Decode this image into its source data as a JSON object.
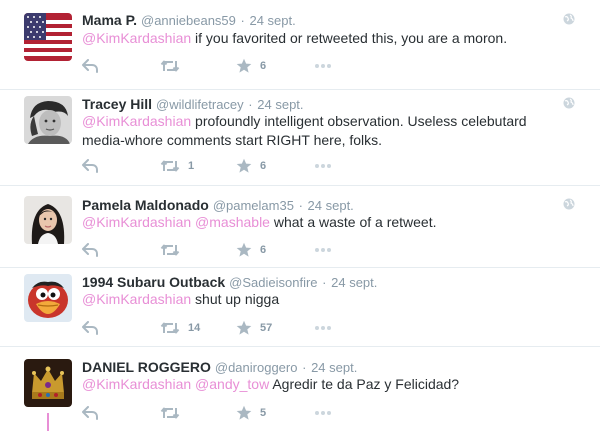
{
  "tweets": [
    {
      "name": "Mama P.",
      "handle": "@anniebeans59",
      "sep": "·",
      "time": "24 sept.",
      "mention1": "@KimKardashian",
      "mention2": "",
      "text": " if you favorited or retweeted this, you are a moron.",
      "retweets": "",
      "favorites": "6",
      "avatar": "us-flag"
    },
    {
      "name": "Tracey Hill",
      "handle": "@wildlifetracey",
      "sep": "·",
      "time": "24 sept.",
      "mention1": "@KimKardashian",
      "mention2": "",
      "text": " profoundly intelligent observation. Useless celebutard media-whore comments start RIGHT here, folks.",
      "retweets": "1",
      "favorites": "6",
      "avatar": "person-bw"
    },
    {
      "name": "Pamela Maldonado",
      "handle": "@pamelam35",
      "sep": "·",
      "time": "24 sept.",
      "mention1": "@KimKardashian",
      "mention2": " @mashable",
      "text": " what a waste of a retweet.",
      "retweets": "",
      "favorites": "6",
      "avatar": "woman-photo"
    },
    {
      "name": "1994 Subaru Outback",
      "handle": "@Sadieisonfire",
      "sep": "·",
      "time": "24 sept.",
      "mention1": "@KimKardashian",
      "mention2": "",
      "text": " shut up nigga",
      "retweets": "14",
      "favorites": "57",
      "avatar": "cartoon-bird"
    },
    {
      "name": "DANIEL ROGGERO",
      "handle": "@daniroggero",
      "sep": "·",
      "time": "24 sept.",
      "mention1": "@KimKardashian",
      "mention2": " @andy_tow",
      "text": " Agredir te da Paz y Felicidad?",
      "retweets": "",
      "favorites": "5",
      "avatar": "crown"
    }
  ],
  "colors": {
    "mention": "#e88fd6",
    "meta": "#8899a6",
    "text": "#292f33",
    "divider": "#e6ecf0"
  },
  "icons": [
    "reply-icon",
    "retweet-icon",
    "favorite-star-icon",
    "more-dots-icon",
    "globe-icon"
  ]
}
